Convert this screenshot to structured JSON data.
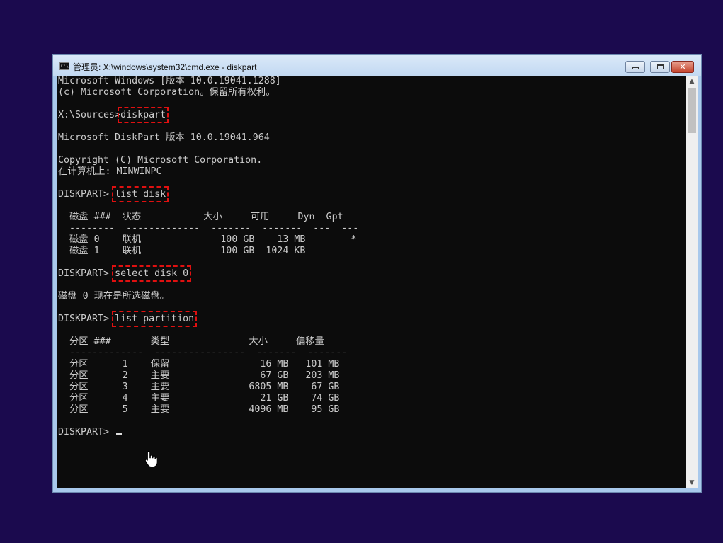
{
  "window": {
    "title": "管理员: X:\\windows\\system32\\cmd.exe - diskpart",
    "icon": "cmd-app-icon",
    "controls": {
      "minimize": "minimize-icon",
      "maximize": "maximize-icon",
      "close": "✕"
    }
  },
  "console": {
    "lines": [
      {
        "text": "Microsoft Windows [版本 10.0.19041.1288]"
      },
      {
        "text": "(c) Microsoft Corporation。保留所有权利。"
      },
      {
        "text": ""
      },
      {
        "text": "X:\\Sources>",
        "cmd": "diskpart"
      },
      {
        "text": ""
      },
      {
        "text": "Microsoft DiskPart 版本 10.0.19041.964"
      },
      {
        "text": ""
      },
      {
        "text": "Copyright (C) Microsoft Corporation."
      },
      {
        "text": "在计算机上: MINWINPC"
      },
      {
        "text": ""
      },
      {
        "text": "DISKPART> ",
        "cmd": "list disk"
      },
      {
        "text": ""
      },
      {
        "text": "  磁盘 ###  状态           大小     可用     Dyn  Gpt"
      },
      {
        "text": "  --------  -------------  -------  -------  ---  ---"
      },
      {
        "text": "  磁盘 0    联机              100 GB    13 MB        *"
      },
      {
        "text": "  磁盘 1    联机              100 GB  1024 KB"
      },
      {
        "text": ""
      },
      {
        "text": "DISKPART> ",
        "cmd": "select disk 0"
      },
      {
        "text": ""
      },
      {
        "text": "磁盘 0 现在是所选磁盘。"
      },
      {
        "text": ""
      },
      {
        "text": "DISKPART> ",
        "cmd": "list partition"
      },
      {
        "text": ""
      },
      {
        "text": "  分区 ###       类型              大小     偏移量"
      },
      {
        "text": "  -------------  ----------------  -------  -------"
      },
      {
        "text": "  分区      1    保留                16 MB   101 MB"
      },
      {
        "text": "  分区      2    主要                67 GB   203 MB"
      },
      {
        "text": "  分区      3    主要              6805 MB    67 GB"
      },
      {
        "text": "  分区      4    主要                21 GB    74 GB"
      },
      {
        "text": "  分区      5    主要              4096 MB    95 GB"
      },
      {
        "text": ""
      },
      {
        "text": "DISKPART> ",
        "caret": true
      }
    ]
  },
  "scrollbar": {
    "up": "▲",
    "down": "▼"
  },
  "pointer": "hand-pointer-icon"
}
